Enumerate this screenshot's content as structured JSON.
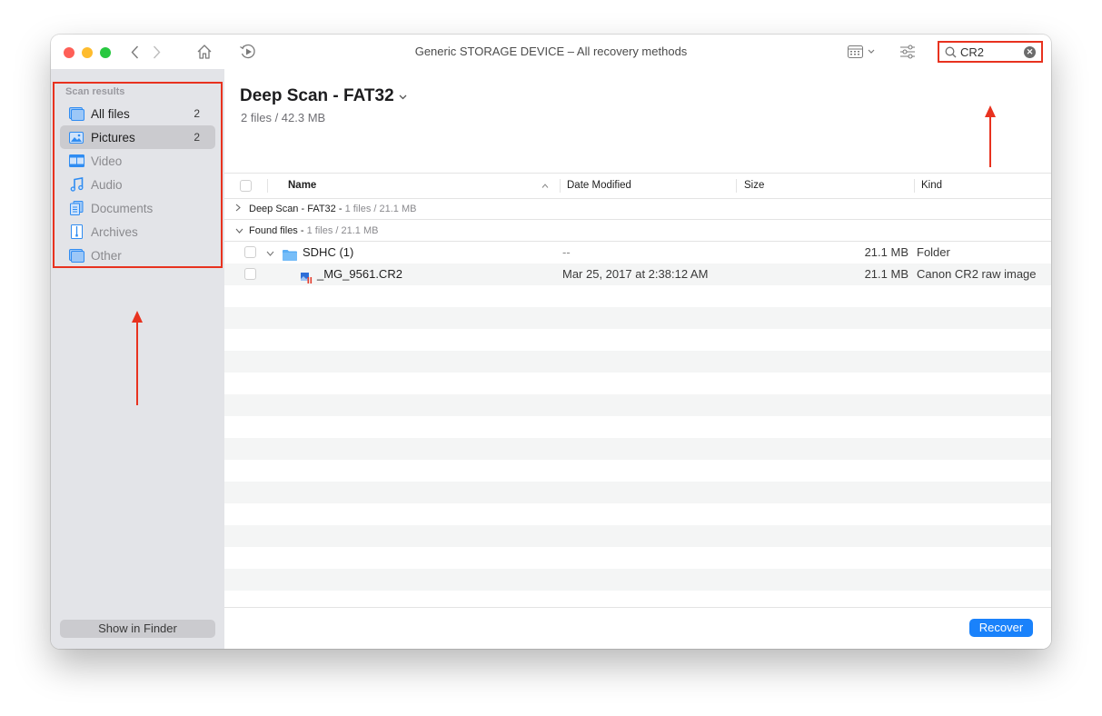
{
  "window": {
    "title": "Generic STORAGE DEVICE – All recovery methods"
  },
  "toolbar": {
    "search_value": "CR2",
    "search_placeholder": "Search",
    "clear_glyph": "✕"
  },
  "sidebar": {
    "heading": "Scan results",
    "items": [
      {
        "label": "All files",
        "count": "2",
        "icon": "all-files-icon"
      },
      {
        "label": "Pictures",
        "count": "2",
        "icon": "pictures-icon"
      },
      {
        "label": "Video",
        "count": "",
        "icon": "video-icon"
      },
      {
        "label": "Audio",
        "count": "",
        "icon": "audio-icon"
      },
      {
        "label": "Documents",
        "count": "",
        "icon": "documents-icon"
      },
      {
        "label": "Archives",
        "count": "",
        "icon": "archives-icon"
      },
      {
        "label": "Other",
        "count": "",
        "icon": "other-icon"
      }
    ],
    "selected_index": 1,
    "show_in_finder_label": "Show in Finder"
  },
  "main": {
    "scan_title": "Deep Scan - FAT32",
    "scan_subtitle": "2 files / 42.3 MB",
    "columns": {
      "name": "Name",
      "date": "Date Modified",
      "size": "Size",
      "kind": "Kind"
    },
    "groups": [
      {
        "title": "Deep Scan - FAT32 -",
        "meta": "1 files / 21.1 MB",
        "expanded": false
      },
      {
        "title": "Found files -",
        "meta": "1 files / 21.1 MB",
        "expanded": true
      }
    ],
    "rows": [
      {
        "name": "SDHC (1)",
        "date": "--",
        "size": "21.1 MB",
        "kind": "Folder",
        "icon": "folder-icon"
      },
      {
        "name": "_MG_9561.CR2",
        "date": "Mar 25, 2017 at 2:38:12 AM",
        "size": "21.1 MB",
        "kind": "Canon CR2 raw image",
        "icon": "raw-image-icon"
      }
    ],
    "recover_label": "Recover"
  },
  "colors": {
    "accent": "#1a82fb",
    "annotation": "#e8321f",
    "sidebar_bg": "#e3e4e8",
    "sidebar_icon": "#2f8cf2"
  }
}
